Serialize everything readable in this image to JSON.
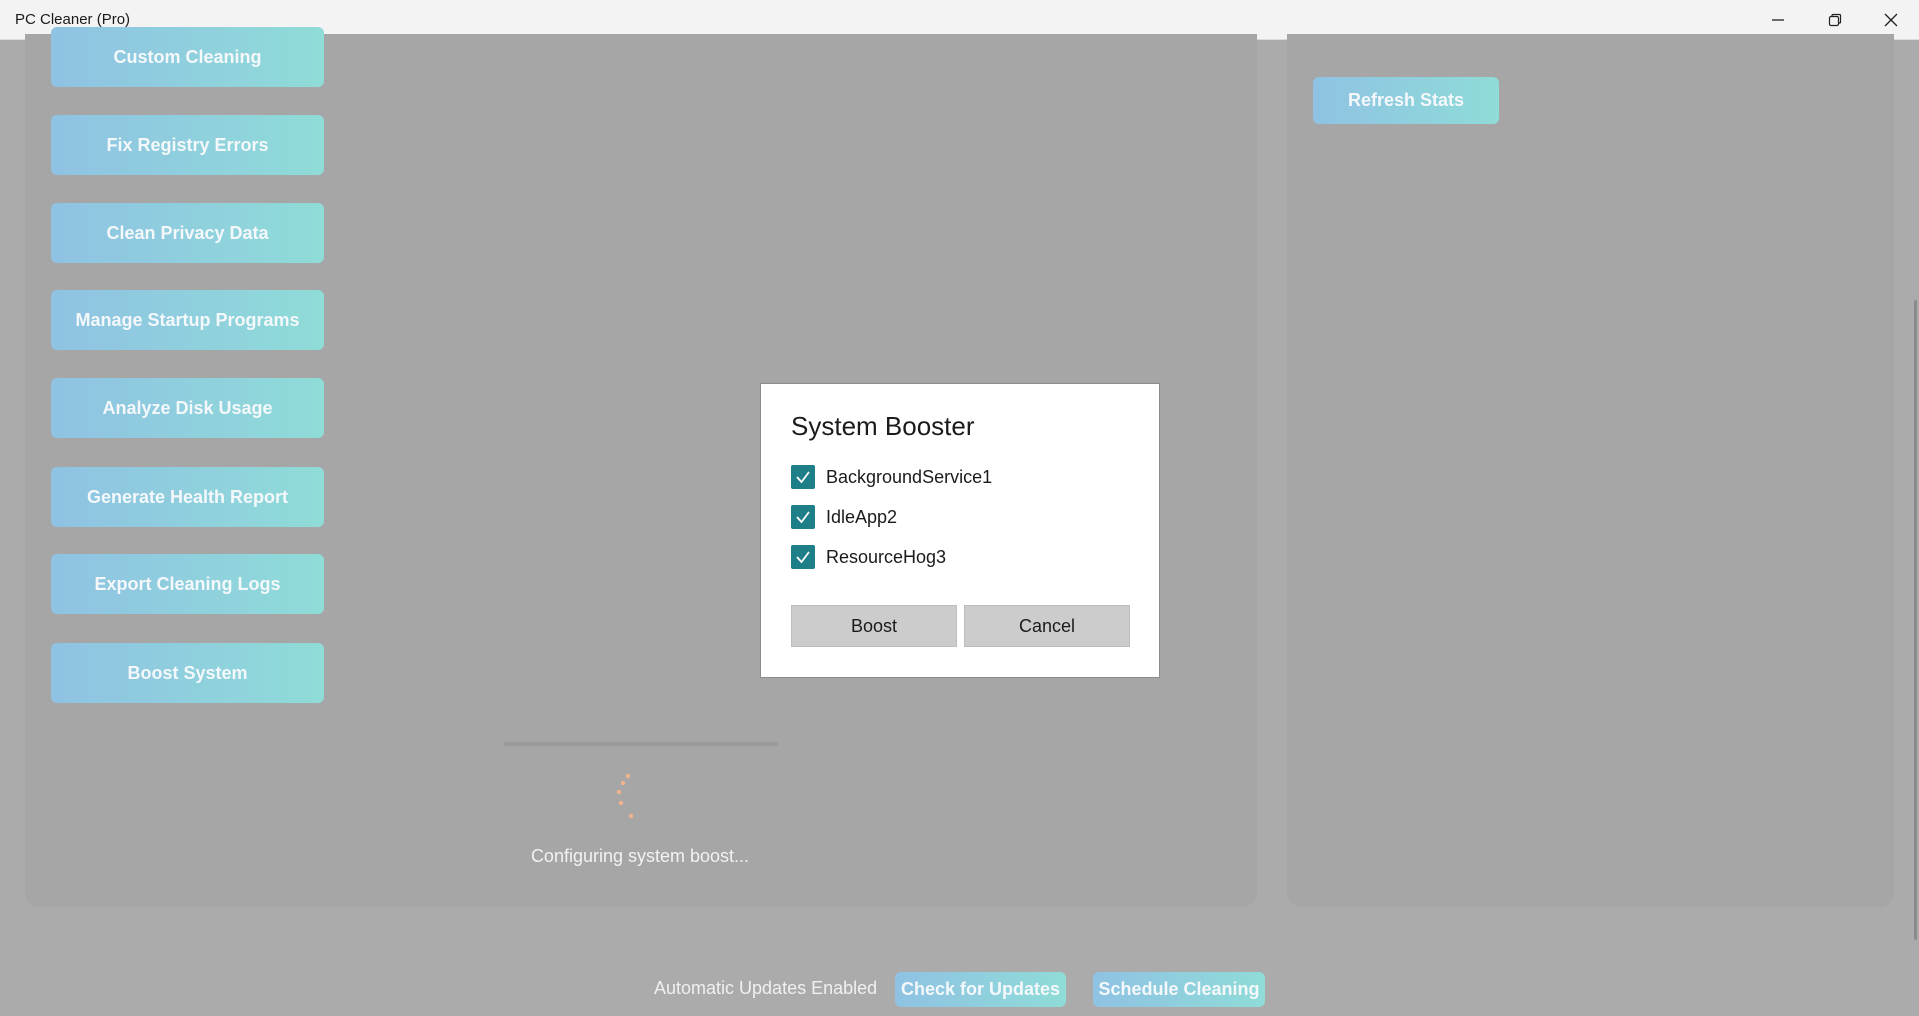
{
  "window": {
    "title": "PC Cleaner (Pro)",
    "controls": [
      "minimize-icon",
      "restore-icon",
      "close-icon"
    ]
  },
  "sidebar": {
    "buttons": [
      {
        "label": "Custom Cleaning"
      },
      {
        "label": "Fix Registry Errors"
      },
      {
        "label": "Clean Privacy Data"
      },
      {
        "label": "Manage Startup Programs"
      },
      {
        "label": "Analyze Disk Usage"
      },
      {
        "label": "Generate Health Report"
      },
      {
        "label": "Export Cleaning Logs"
      },
      {
        "label": "Boost System"
      }
    ]
  },
  "stats": {
    "refresh_label": "Refresh Stats"
  },
  "progress": {
    "status_text": "Configuring system boost..."
  },
  "footer": {
    "auto_updates_label": "Automatic Updates Enabled",
    "check_updates_label": "Check for Updates",
    "schedule_label": "Schedule Cleaning"
  },
  "dialog": {
    "title": "System Booster",
    "items": [
      {
        "label": "BackgroundService1",
        "checked": true
      },
      {
        "label": "IdleApp2",
        "checked": true
      },
      {
        "label": "ResourceHog3",
        "checked": true
      }
    ],
    "boost_label": "Boost",
    "cancel_label": "Cancel"
  },
  "colors": {
    "accent_gradient_start": "#8fc2e3",
    "accent_gradient_end": "#8fdcd8",
    "checkbox": "#1f7f88",
    "spinner": "#f0b48c",
    "overlay": "#ababab"
  }
}
